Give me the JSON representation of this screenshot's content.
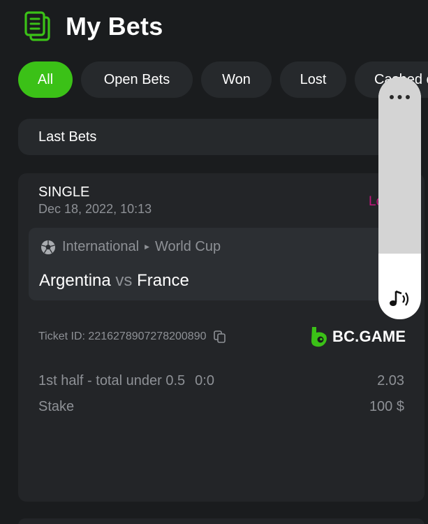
{
  "header": {
    "title": "My Bets",
    "icon": "bets-list-icon"
  },
  "filters": {
    "tabs": [
      {
        "label": "All",
        "active": true
      },
      {
        "label": "Open Bets",
        "active": false
      },
      {
        "label": "Won",
        "active": false
      },
      {
        "label": "Lost",
        "active": false
      },
      {
        "label": "Cashed out",
        "active": false
      }
    ]
  },
  "section": {
    "label": "Last Bets"
  },
  "bet": {
    "type": "SINGLE",
    "date": "Dec 18, 2022, 10:13",
    "status": "Lost",
    "event": {
      "sport_icon": "soccer-ball-icon",
      "category": "International",
      "league": "World Cup",
      "home": "Argentina",
      "vs": "vs",
      "away": "France"
    },
    "ticket_label": "Ticket ID:",
    "ticket_id": "2216278907278200890",
    "brand": "BC.GAME",
    "market": "1st half - total under 0.5",
    "score": "0:0",
    "odds": "2.03",
    "stake_label": "Stake",
    "stake_value": "100 $"
  },
  "colors": {
    "background": "#1a1c1e",
    "card": "#232528",
    "accent": "#3bc117",
    "status_lost": "#c4167d"
  },
  "overlay": {
    "more_icon": "more-horizontal-icon",
    "sound_icon": "sound-icon",
    "volume_level": 0.27
  }
}
